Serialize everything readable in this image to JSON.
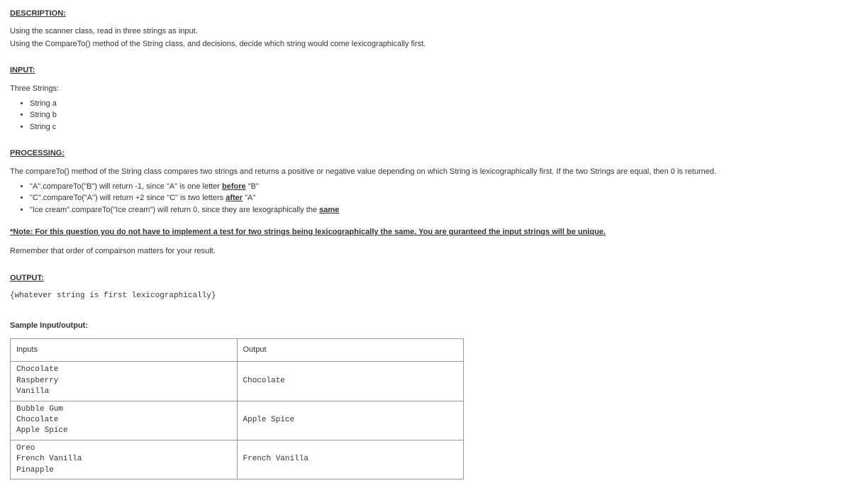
{
  "headings": {
    "description": "DESCRIPTION:",
    "input": "INPUT:",
    "processing": "PROCESSING:",
    "output": "OUTPUT:",
    "sample": "Sample Input/output:"
  },
  "description": {
    "line1": "Using the scanner class, read in three strings as input.",
    "line2": "Using the CompareTo() method of the String class, and decisions, decide which string would come lexicographically first."
  },
  "input": {
    "intro": "Three Strings:",
    "items": [
      "String a",
      "String b",
      "String c"
    ]
  },
  "processing": {
    "intro": "The compareTo() method of the String class compares two strings and returns a positive or negative value depending on which String is lexicographically first. If the two Strings are equal, then 0 is returned.",
    "bullets": [
      {
        "pre": "\"A\".compareTo(\"B\") will return -1, since \"A\" is one letter ",
        "u": "before",
        "post": " \"B\""
      },
      {
        "pre": "\"C\".compareTo(\"A\") will return +2 since \"C\" is two letters ",
        "u": "after",
        "post": " \"A\""
      },
      {
        "pre": "\"Ice cream\".compareTo(\"Ice cream\") will return 0, since they are lexographically the ",
        "u": "same",
        "post": ""
      }
    ],
    "note": "*Note: For this question you do not have to implement a test for two strings being lexicographically the same. You are guranteed the input strings will be unique.",
    "remember": "Remember that order of compairson matters for your result."
  },
  "output": {
    "line": "{whatever string is first lexicographically}"
  },
  "table": {
    "headers": {
      "inputs": "Inputs",
      "output": "Output"
    },
    "rows": [
      {
        "inputs": "Chocolate\nRaspberry\nVanilla",
        "output": "Chocolate"
      },
      {
        "inputs": "Bubble Gum\nChocolate\nApple Spice",
        "output": "Apple Spice"
      },
      {
        "inputs": "Oreo\nFrench Vanilla\nPinapple",
        "output": "French Vanilla"
      }
    ]
  }
}
